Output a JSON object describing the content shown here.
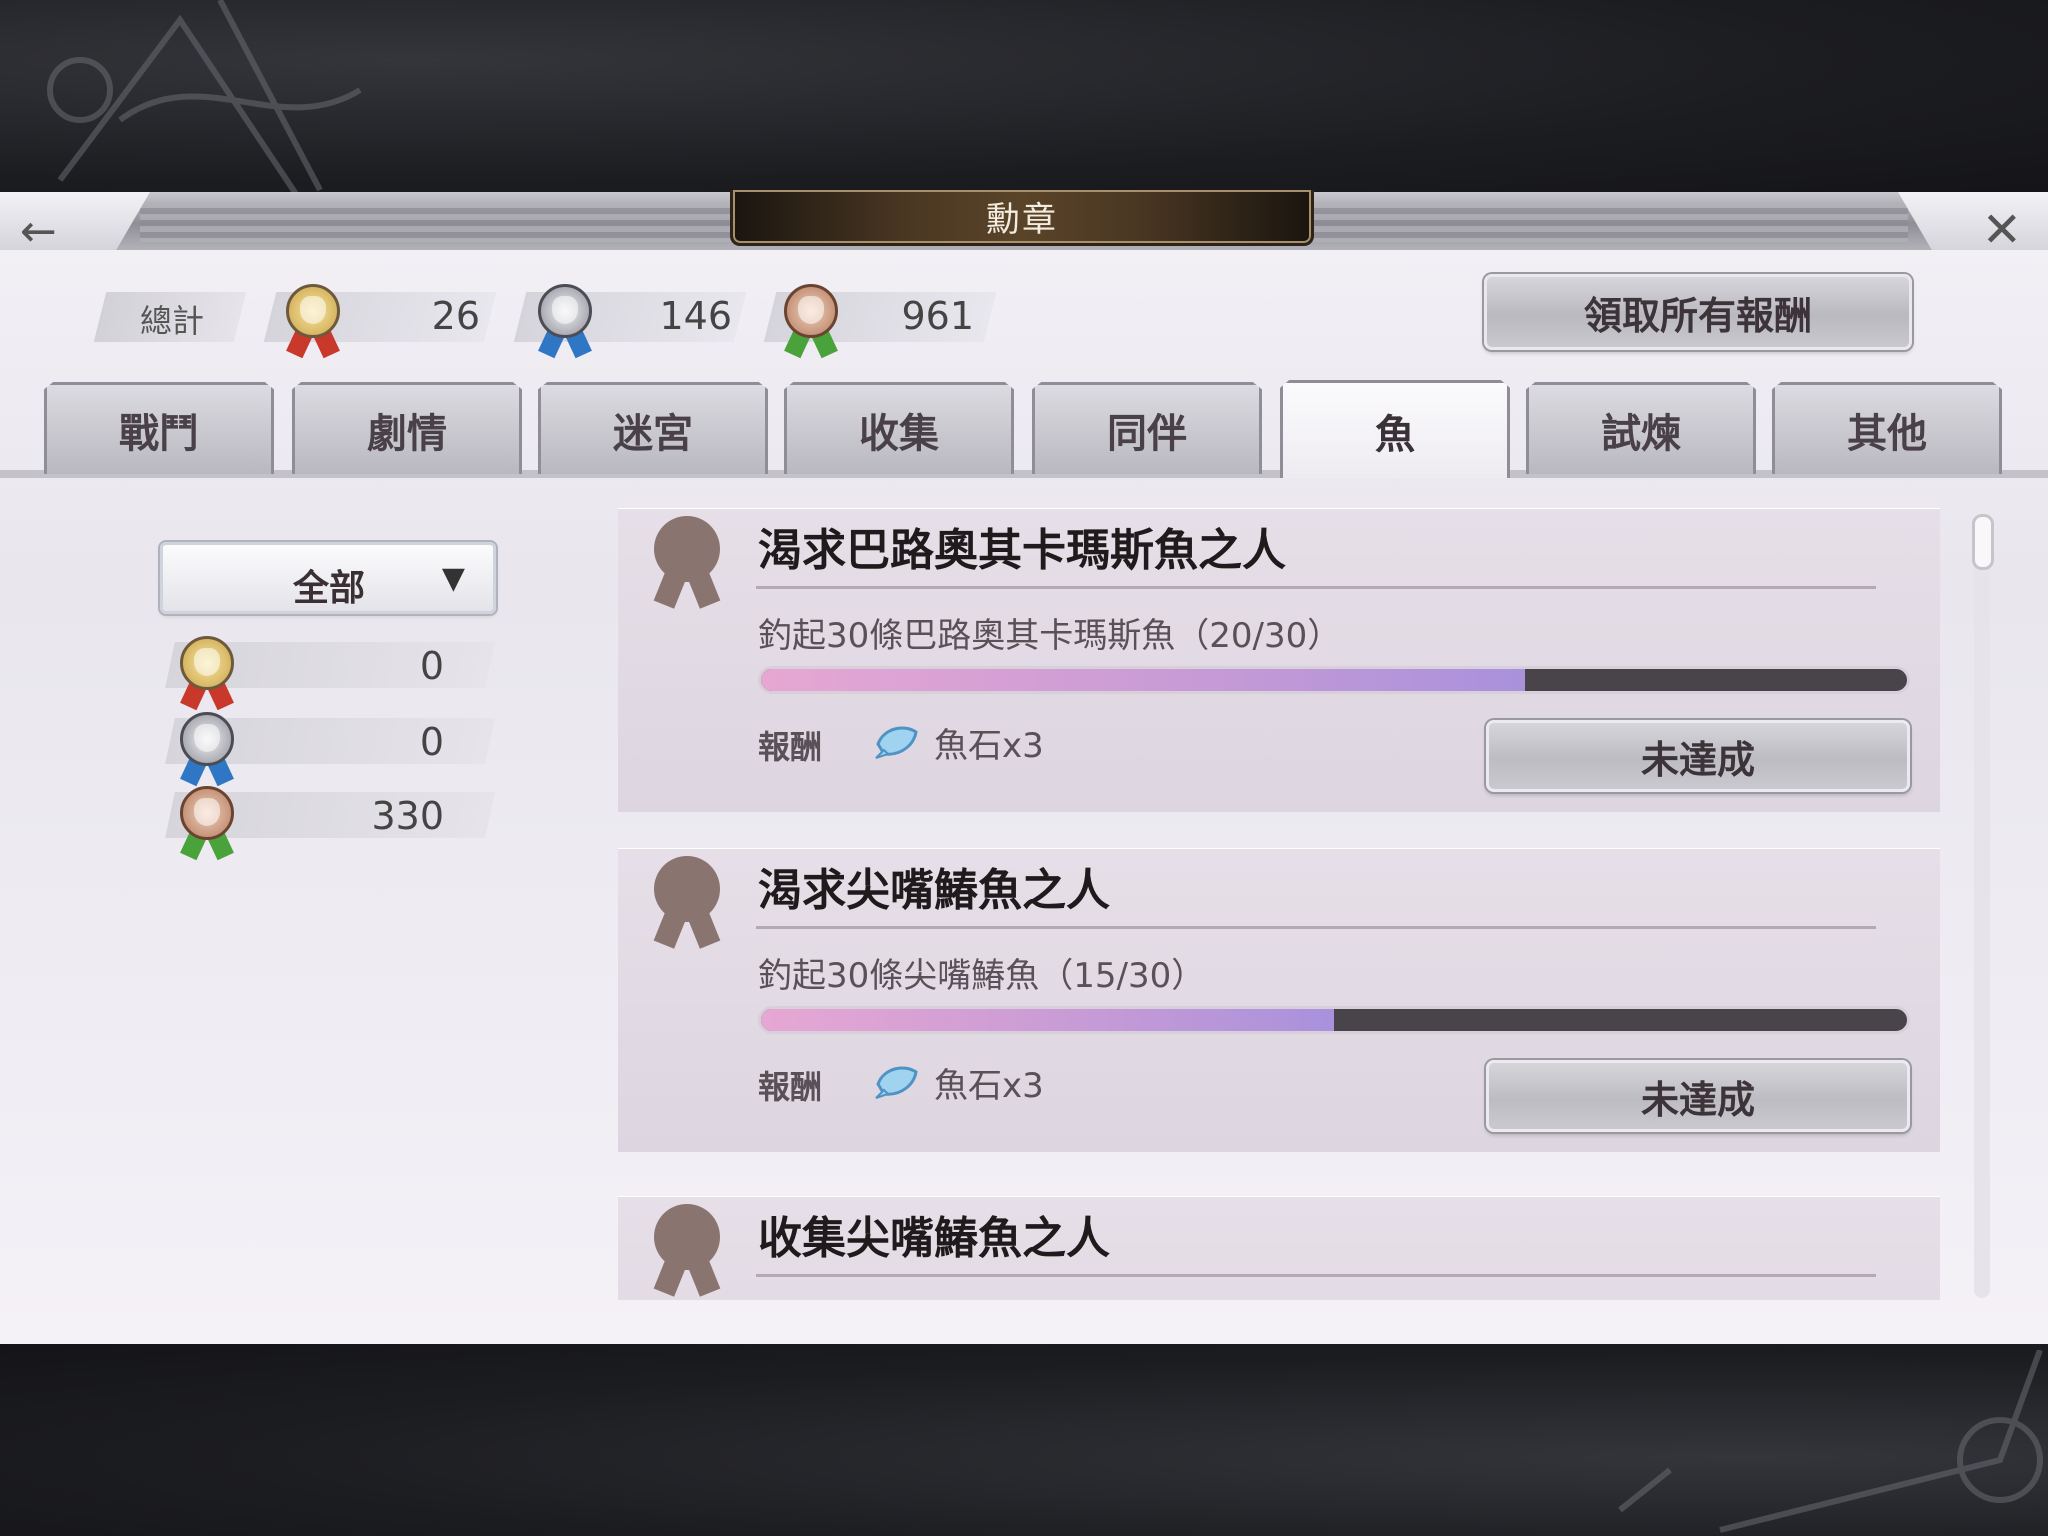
{
  "header": {
    "title": "勳章",
    "back_icon": "arrow-left-icon",
    "close_icon": "close-icon"
  },
  "summary": {
    "label": "總計",
    "gold": "26",
    "silver": "146",
    "bronze": "961"
  },
  "claim_all_label": "領取所有報酬",
  "tabs": [
    {
      "label": "戰鬥",
      "active": false
    },
    {
      "label": "劇情",
      "active": false
    },
    {
      "label": "迷宮",
      "active": false
    },
    {
      "label": "收集",
      "active": false
    },
    {
      "label": "同伴",
      "active": false
    },
    {
      "label": "魚",
      "active": true
    },
    {
      "label": "試煉",
      "active": false
    },
    {
      "label": "其他",
      "active": false
    }
  ],
  "sidebar": {
    "filter_label": "全部",
    "counts": {
      "gold": "0",
      "silver": "0",
      "bronze": "330"
    }
  },
  "achievements": [
    {
      "title": "渴求巴路奧其卡瑪斯魚之人",
      "description": "釣起30條巴路奧其卡瑪斯魚（20/30）",
      "progress": 0.6667,
      "reward_label": "報酬",
      "reward_text": "魚石x3",
      "status": "未達成"
    },
    {
      "title": "渴求尖嘴鰆魚之人",
      "description": "釣起30條尖嘴鰆魚（15/30）",
      "progress": 0.5,
      "reward_label": "報酬",
      "reward_text": "魚石x3",
      "status": "未達成"
    },
    {
      "title": "收集尖嘴鰆魚之人"
    }
  ],
  "colors": {
    "gold_ribbon": "#c8382b",
    "silver_ribbon": "#2f77c4",
    "bronze_ribbon": "#4aa23a",
    "progress_fill_start": "#e7a7d3",
    "progress_fill_end": "#a991dc",
    "progress_track": "#48444a"
  }
}
